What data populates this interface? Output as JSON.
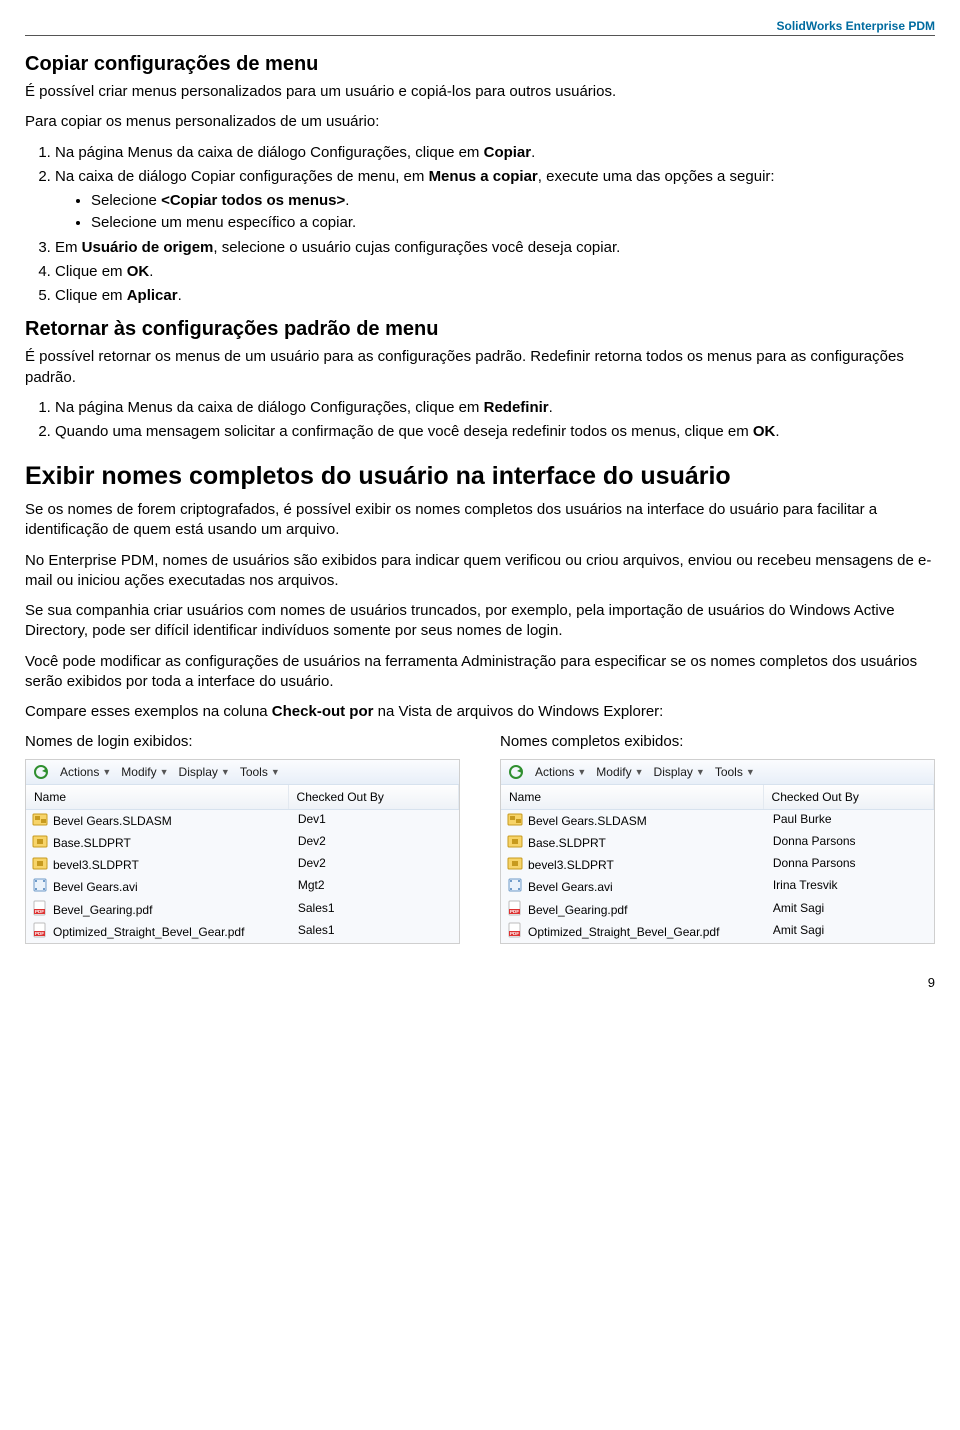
{
  "header": {
    "product": "SolidWorks Enterprise PDM"
  },
  "sec1": {
    "title": "Copiar configurações de menu",
    "intro": "É possível criar menus personalizados para um usuário e copiá-los para outros usuários.",
    "lead": "Para copiar os menus personalizados de um usuário:",
    "step1_a": "Na página Menus da caixa de diálogo Configurações, clique em ",
    "step1_b": "Copiar",
    "step1_c": ".",
    "step2_a": "Na caixa de diálogo Copiar configurações de menu, em ",
    "step2_b": "Menus a copiar",
    "step2_c": ", execute uma das opções a seguir:",
    "bullet1_a": "Selecione ",
    "bullet1_b": "<Copiar todos os menus>",
    "bullet1_c": ".",
    "bullet2": "Selecione um menu específico a copiar.",
    "step3_a": "Em ",
    "step3_b": "Usuário de origem",
    "step3_c": ", selecione o usuário cujas configurações você deseja copiar.",
    "step4_a": "Clique em ",
    "step4_b": "OK",
    "step4_c": ".",
    "step5_a": "Clique em ",
    "step5_b": "Aplicar",
    "step5_c": "."
  },
  "sec2": {
    "title": "Retornar às configurações padrão de menu",
    "intro": "É possível retornar os menus de um usuário para as configurações padrão. Redefinir retorna todos os menus para as configurações padrão.",
    "step1_a": "Na página Menus da caixa de diálogo Configurações, clique em ",
    "step1_b": "Redefinir",
    "step1_c": ".",
    "step2_a": "Quando uma mensagem solicitar a confirmação de que você deseja redefinir todos os menus, clique em ",
    "step2_b": "OK",
    "step2_c": "."
  },
  "sec3": {
    "title": "Exibir nomes completos do usuário na interface do usuário",
    "p1": "Se os nomes de forem criptografados, é possível exibir os nomes completos dos usuários na interface do usuário para facilitar a identificação de quem está usando um arquivo.",
    "p2": "No Enterprise PDM, nomes de usuários são exibidos para indicar quem verificou ou criou arquivos, enviou ou recebeu mensagens de e-mail ou iniciou ações executadas nos arquivos.",
    "p3": "Se sua companhia criar usuários com nomes de usuários truncados, por exemplo, pela importação de usuários do Windows Active Directory, pode ser difícil identificar indivíduos somente por seus nomes de login.",
    "p4": "Você pode modificar as configurações de usuários na ferramenta Administração para especificar se os nomes completos dos usuários serão exibidos por toda a interface do usuário.",
    "p5_a": "Compare esses exemplos na coluna ",
    "p5_b": "Check-out por",
    "p5_c": " na Vista de arquivos do Windows Explorer:"
  },
  "compare": {
    "left_label": "Nomes de login exibidos:",
    "right_label": "Nomes completos exibidos:"
  },
  "toolbar": {
    "actions": "Actions",
    "modify": "Modify",
    "display": "Display",
    "tools": "Tools"
  },
  "columns": {
    "name": "Name",
    "checked_out_by": "Checked Out By"
  },
  "files": [
    {
      "name": "Bevel Gears.SLDASM",
      "ico": "asm"
    },
    {
      "name": "Base.SLDPRT",
      "ico": "prt"
    },
    {
      "name": "bevel3.SLDPRT",
      "ico": "prt"
    },
    {
      "name": "Bevel Gears.avi",
      "ico": "avi"
    },
    {
      "name": "Bevel_Gearing.pdf",
      "ico": "pdf"
    },
    {
      "name": "Optimized_Straight_Bevel_Gear.pdf",
      "ico": "pdf"
    }
  ],
  "left_out": [
    "Dev1",
    "Dev2",
    "Dev2",
    "Mgt2",
    "Sales1",
    "Sales1"
  ],
  "right_out": [
    "Paul Burke",
    "Donna Parsons",
    "Donna Parsons",
    "Irina Tresvik",
    "Amit Sagi",
    "Amit Sagi"
  ],
  "page_number": "9"
}
